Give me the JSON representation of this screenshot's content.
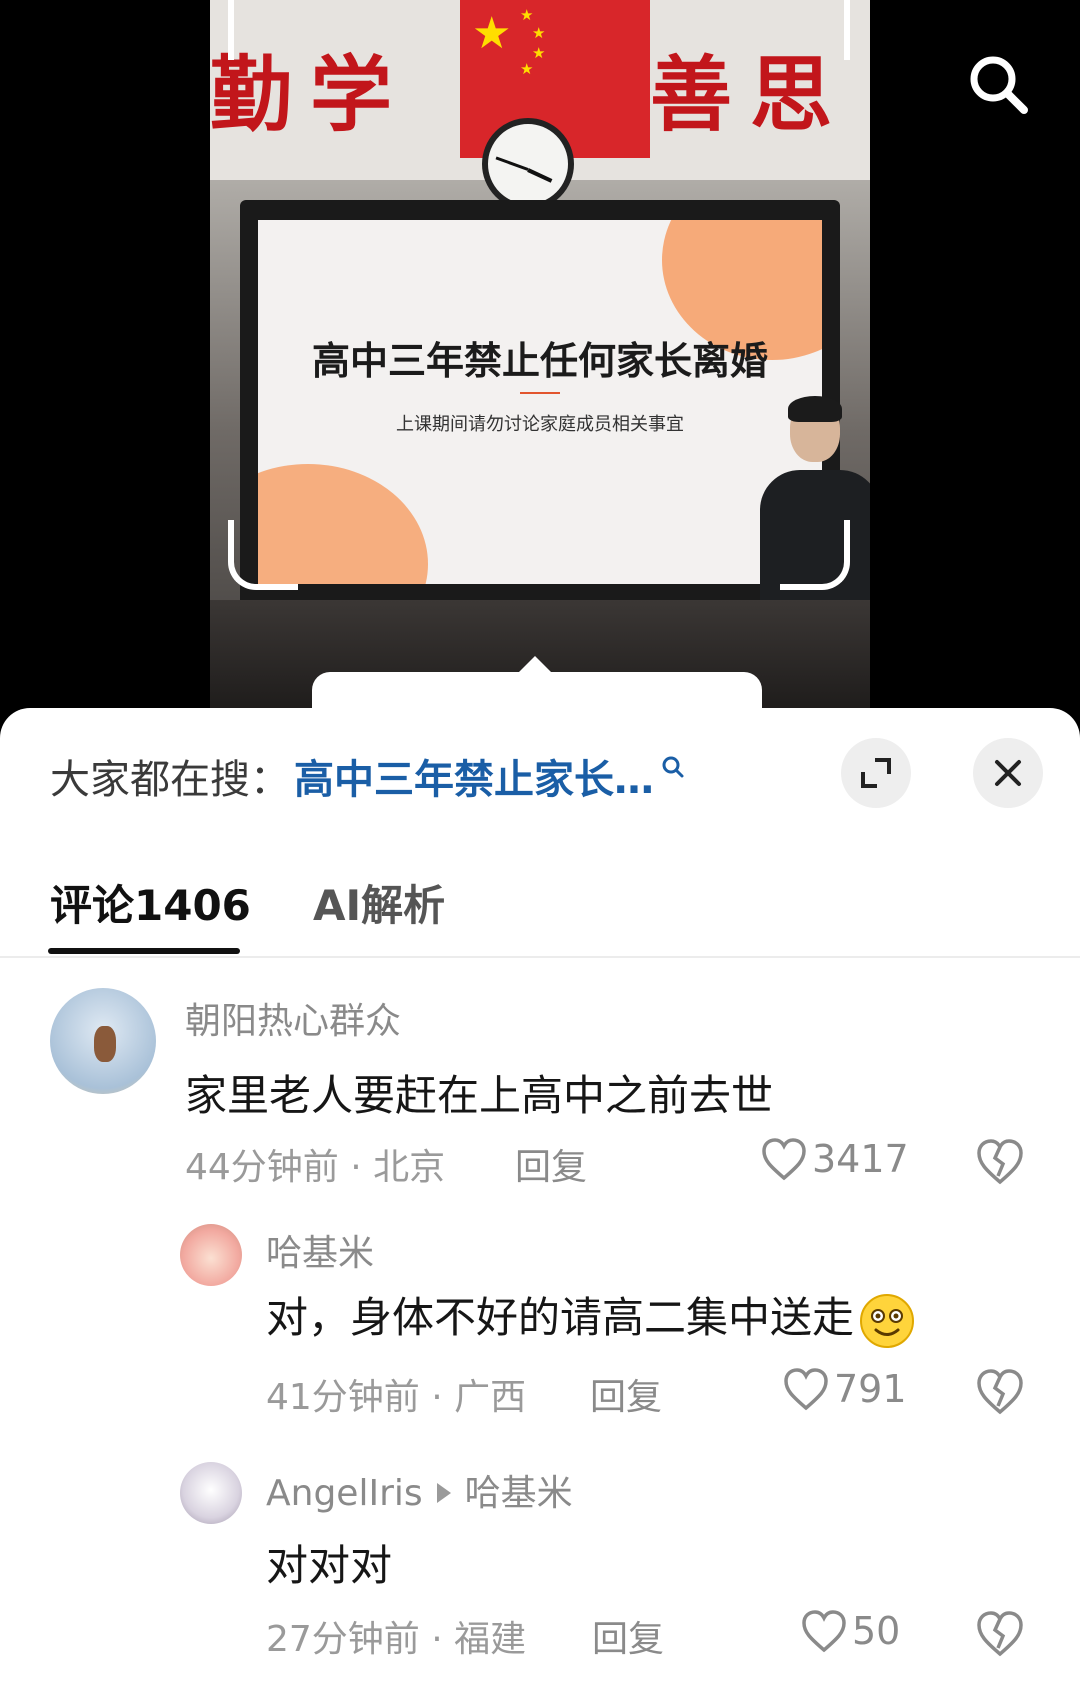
{
  "video": {
    "motto_left": "勤学",
    "motto_right": "善思",
    "slide_title": "高中三年禁止任何家长离婚",
    "slide_subtitle": "上课期间请勿讨论家庭成员相关事宜"
  },
  "search_bar": {
    "label": "大家都在搜：",
    "query": "高中三年禁止家长…"
  },
  "tabs": [
    {
      "label": "评论1406",
      "active": true
    },
    {
      "label": "AI解析",
      "active": false
    }
  ],
  "comments": [
    {
      "user": "朝阳热心群众",
      "text": "家里老人要赶在上高中之前去世",
      "time": "44分钟前",
      "location": "北京",
      "reply_label": "回复",
      "likes": "3417"
    },
    {
      "user": "哈基米",
      "text": "对，身体不好的请高二集中送走",
      "emoji": "smiling-face-emoji",
      "time": "41分钟前",
      "location": "广西",
      "reply_label": "回复",
      "likes": "791"
    },
    {
      "user": "AngelIris",
      "reply_to": "哈基米",
      "text": "对对对",
      "time": "27分钟前",
      "location": "福建",
      "reply_label": "回复",
      "likes": "50"
    }
  ],
  "colors": {
    "link_blue": "#1a5ea6",
    "motto_red": "#c2161b",
    "slide_orange": "#f6a26b"
  }
}
